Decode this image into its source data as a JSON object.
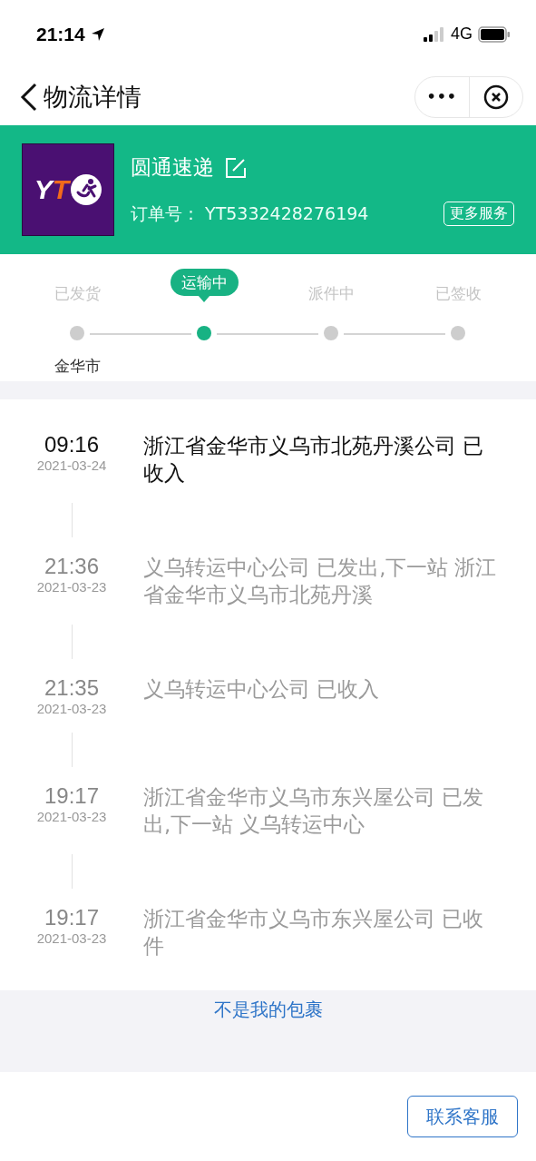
{
  "status_bar": {
    "time": "21:14",
    "network": "4G"
  },
  "nav": {
    "title": "物流详情",
    "more": "•••"
  },
  "carrier": {
    "logo": {
      "letter_1": "Y",
      "letter_2": "T"
    },
    "name": "圆通速递",
    "order_label": "订单号：",
    "order_number": "YT5332428276194",
    "more_services": "更多服务"
  },
  "steps": [
    {
      "label": "已发货",
      "selected": false,
      "location": "金华市"
    },
    {
      "label": "运输中",
      "selected": true
    },
    {
      "label": "派件中",
      "selected": false
    },
    {
      "label": "已签收",
      "selected": false
    }
  ],
  "events": [
    {
      "time": "09:16",
      "date": "2021-03-24",
      "text": "浙江省金华市义乌市北苑丹溪公司 已收入",
      "latest": true
    },
    {
      "time": "21:36",
      "date": "2021-03-23",
      "text": "义乌转运中心公司 已发出,下一站 浙江省金华市义乌市北苑丹溪",
      "latest": false
    },
    {
      "time": "21:35",
      "date": "2021-03-23",
      "text": "义乌转运中心公司 已收入",
      "latest": false
    },
    {
      "time": "19:17",
      "date": "2021-03-23",
      "text": "浙江省金华市义乌市东兴屋公司 已发出,下一站 义乌转运中心",
      "latest": false
    },
    {
      "time": "19:17",
      "date": "2021-03-23",
      "text": "浙江省金华市义乌市东兴屋公司 已收件",
      "latest": false
    }
  ],
  "not_mine_link": "不是我的包裹",
  "contact_button": "联系客服"
}
